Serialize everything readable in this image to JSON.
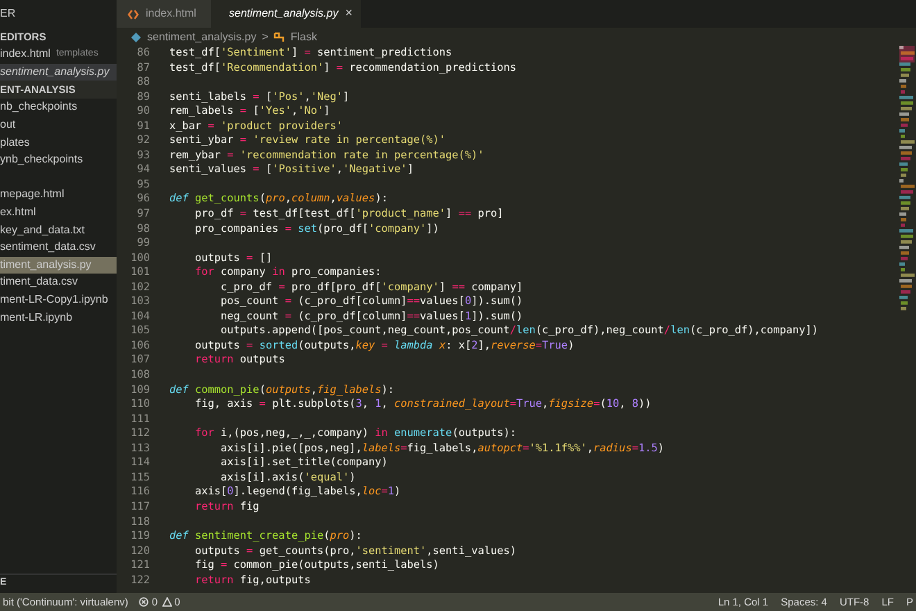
{
  "sidebar": {
    "title": "ER",
    "sections": [
      {
        "title": "EDITORS",
        "items": [
          {
            "label": "index.html",
            "hint": "templates",
            "selected": false,
            "italic": false
          },
          {
            "label": "sentiment_analysis.py",
            "selected": true,
            "italic": true
          }
        ]
      },
      {
        "title": "ENT-ANALYSIS",
        "items": [
          {
            "label": "nb_checkpoints",
            "selected": false
          },
          {
            "label": "out",
            "selected": false
          },
          {
            "label": "plates",
            "selected": false
          },
          {
            "label": "ynb_checkpoints",
            "selected": false
          },
          {
            "label": "mepage.html",
            "selected": false,
            "separated": true
          },
          {
            "label": "ex.html",
            "selected": false
          },
          {
            "label": "key_and_data.txt",
            "selected": false
          },
          {
            "label": "sentiment_data.csv",
            "selected": false
          },
          {
            "label": "timent_analysis.py",
            "selected": true
          },
          {
            "label": "timent_data.csv",
            "selected": false
          },
          {
            "label": "ment-LR-Copy1.ipynb",
            "selected": false
          },
          {
            "label": "ment-LR.ipynb",
            "selected": false
          }
        ]
      }
    ],
    "bottom": "E"
  },
  "tabs": [
    {
      "label": "index.html",
      "kind": "html",
      "selected": false
    },
    {
      "label": "sentiment_analysis.py",
      "kind": "python",
      "selected": true,
      "close": "×"
    }
  ],
  "breadcrumb": {
    "file": "sentiment_analysis.py",
    "separator": ">",
    "symbol": "Flask"
  },
  "code": [
    {
      "num": "86",
      "tokens": [
        {
          "kind": "plain",
          "text": "test_df["
        },
        {
          "kind": "string",
          "text": "'Sentiment'"
        },
        {
          "kind": "plain",
          "text": "] "
        },
        {
          "kind": "operator",
          "text": "="
        },
        {
          "kind": "plain",
          "text": " sentiment_predictions"
        }
      ]
    },
    {
      "num": "87",
      "tokens": [
        {
          "kind": "plain",
          "text": "test_df["
        },
        {
          "kind": "string",
          "text": "'Recommendation'"
        },
        {
          "kind": "plain",
          "text": "] "
        },
        {
          "kind": "operator",
          "text": "="
        },
        {
          "kind": "plain",
          "text": " recommendation_predictions"
        }
      ]
    },
    {
      "num": "88"
    },
    {
      "num": "89",
      "tokens": [
        {
          "kind": "plain",
          "text": "senti_labels "
        },
        {
          "kind": "operator",
          "text": "="
        },
        {
          "kind": "plain",
          "text": " ["
        },
        {
          "kind": "string",
          "text": "'Pos'"
        },
        {
          "kind": "plain",
          "text": ","
        },
        {
          "kind": "string",
          "text": "'Neg'"
        },
        {
          "kind": "plain",
          "text": "]"
        }
      ]
    },
    {
      "num": "90",
      "tokens": [
        {
          "kind": "plain",
          "text": "rem_labels "
        },
        {
          "kind": "operator",
          "text": "="
        },
        {
          "kind": "plain",
          "text": " ["
        },
        {
          "kind": "string",
          "text": "'Yes'"
        },
        {
          "kind": "plain",
          "text": ","
        },
        {
          "kind": "string",
          "text": "'No'"
        },
        {
          "kind": "plain",
          "text": "]"
        }
      ]
    },
    {
      "num": "91",
      "tokens": [
        {
          "kind": "plain",
          "text": "x_bar "
        },
        {
          "kind": "operator",
          "text": "="
        },
        {
          "kind": "string",
          "text": " 'product providers'"
        }
      ]
    },
    {
      "num": "92",
      "tokens": [
        {
          "kind": "plain",
          "text": "senti_ybar "
        },
        {
          "kind": "operator",
          "text": "="
        },
        {
          "kind": "string",
          "text": " 'review rate in percentage(%)'"
        }
      ]
    },
    {
      "num": "93",
      "tokens": [
        {
          "kind": "plain",
          "text": "rem_ybar "
        },
        {
          "kind": "operator",
          "text": "="
        },
        {
          "kind": "string",
          "text": " 'recommendation rate in percentage(%)'"
        }
      ]
    },
    {
      "num": "94",
      "tokens": [
        {
          "kind": "plain",
          "text": "senti_values "
        },
        {
          "kind": "operator",
          "text": "="
        },
        {
          "kind": "plain",
          "text": " ["
        },
        {
          "kind": "string",
          "text": "'Positive'"
        },
        {
          "kind": "plain",
          "text": ","
        },
        {
          "kind": "string",
          "text": "'Negative'"
        },
        {
          "kind": "plain",
          "text": "]"
        }
      ]
    },
    {
      "num": "95"
    },
    {
      "num": "96",
      "tokens": [
        {
          "kind": "storage",
          "text": "def"
        },
        {
          "kind": "function",
          "text": " get_counts"
        },
        {
          "kind": "plain",
          "text": "("
        },
        {
          "kind": "param",
          "text": "pro"
        },
        {
          "kind": "plain",
          "text": ","
        },
        {
          "kind": "param",
          "text": "column"
        },
        {
          "kind": "plain",
          "text": ","
        },
        {
          "kind": "param",
          "text": "values"
        },
        {
          "kind": "plain",
          "text": "):"
        }
      ]
    },
    {
      "num": "97",
      "tokens": [
        {
          "kind": "plain",
          "text": "    pro_df "
        },
        {
          "kind": "operator",
          "text": "="
        },
        {
          "kind": "plain",
          "text": " test_df[test_df["
        },
        {
          "kind": "string",
          "text": "'product_name'"
        },
        {
          "kind": "plain",
          "text": "] "
        },
        {
          "kind": "operator",
          "text": "=="
        },
        {
          "kind": "plain",
          "text": " pro]"
        }
      ]
    },
    {
      "num": "98",
      "tokens": [
        {
          "kind": "plain",
          "text": "    pro_companies "
        },
        {
          "kind": "operator",
          "text": "="
        },
        {
          "kind": "builtin",
          "text": " set"
        },
        {
          "kind": "plain",
          "text": "(pro_df["
        },
        {
          "kind": "string",
          "text": "'company'"
        },
        {
          "kind": "plain",
          "text": "])"
        }
      ]
    },
    {
      "num": "99"
    },
    {
      "num": "100",
      "tokens": [
        {
          "kind": "plain",
          "text": "    outputs "
        },
        {
          "kind": "operator",
          "text": "="
        },
        {
          "kind": "plain",
          "text": " []"
        }
      ]
    },
    {
      "num": "101",
      "tokens": [
        {
          "kind": "keyword",
          "text": "    for"
        },
        {
          "kind": "plain",
          "text": " company "
        },
        {
          "kind": "keyword",
          "text": "in"
        },
        {
          "kind": "plain",
          "text": " pro_companies:"
        }
      ]
    },
    {
      "num": "102",
      "tokens": [
        {
          "kind": "plain",
          "text": "        c_pro_df "
        },
        {
          "kind": "operator",
          "text": "="
        },
        {
          "kind": "plain",
          "text": " pro_df[pro_df["
        },
        {
          "kind": "string",
          "text": "'company'"
        },
        {
          "kind": "plain",
          "text": "] "
        },
        {
          "kind": "operator",
          "text": "=="
        },
        {
          "kind": "plain",
          "text": " company]"
        }
      ]
    },
    {
      "num": "103",
      "tokens": [
        {
          "kind": "plain",
          "text": "        pos_count "
        },
        {
          "kind": "operator",
          "text": "="
        },
        {
          "kind": "plain",
          "text": " (c_pro_df[column]"
        },
        {
          "kind": "operator",
          "text": "=="
        },
        {
          "kind": "plain",
          "text": "values["
        },
        {
          "kind": "number",
          "text": "0"
        },
        {
          "kind": "plain",
          "text": "]).sum()"
        }
      ]
    },
    {
      "num": "104",
      "tokens": [
        {
          "kind": "plain",
          "text": "        neg_count "
        },
        {
          "kind": "operator",
          "text": "="
        },
        {
          "kind": "plain",
          "text": " (c_pro_df[column]"
        },
        {
          "kind": "operator",
          "text": "=="
        },
        {
          "kind": "plain",
          "text": "values["
        },
        {
          "kind": "number",
          "text": "1"
        },
        {
          "kind": "plain",
          "text": "]).sum()"
        }
      ]
    },
    {
      "num": "105",
      "tokens": [
        {
          "kind": "plain",
          "text": "        outputs.append([pos_count,neg_count,pos_count"
        },
        {
          "kind": "operator",
          "text": "/"
        },
        {
          "kind": "builtin",
          "text": "len"
        },
        {
          "kind": "plain",
          "text": "(c_pro_df),neg_count"
        },
        {
          "kind": "operator",
          "text": "/"
        },
        {
          "kind": "builtin",
          "text": "len"
        },
        {
          "kind": "plain",
          "text": "(c_pro_df),company])"
        }
      ]
    },
    {
      "num": "106",
      "tokens": [
        {
          "kind": "plain",
          "text": "    outputs "
        },
        {
          "kind": "operator",
          "text": "="
        },
        {
          "kind": "builtin",
          "text": " sorted"
        },
        {
          "kind": "plain",
          "text": "(outputs,"
        },
        {
          "kind": "param",
          "text": "key"
        },
        {
          "kind": "operator",
          "text": " ="
        },
        {
          "kind": "storage",
          "text": " lambda"
        },
        {
          "kind": "param",
          "text": " x"
        },
        {
          "kind": "plain",
          "text": ": x["
        },
        {
          "kind": "number",
          "text": "2"
        },
        {
          "kind": "plain",
          "text": "],"
        },
        {
          "kind": "param",
          "text": "reverse"
        },
        {
          "kind": "operator",
          "text": "="
        },
        {
          "kind": "number",
          "text": "True"
        },
        {
          "kind": "plain",
          "text": ")"
        }
      ]
    },
    {
      "num": "107",
      "tokens": [
        {
          "kind": "keyword",
          "text": "    return"
        },
        {
          "kind": "plain",
          "text": " outputs"
        }
      ]
    },
    {
      "num": "108"
    },
    {
      "num": "109",
      "tokens": [
        {
          "kind": "storage",
          "text": "def"
        },
        {
          "kind": "function",
          "text": " common_pie"
        },
        {
          "kind": "plain",
          "text": "("
        },
        {
          "kind": "param",
          "text": "outputs"
        },
        {
          "kind": "plain",
          "text": ","
        },
        {
          "kind": "param",
          "text": "fig_labels"
        },
        {
          "kind": "plain",
          "text": "):"
        }
      ]
    },
    {
      "num": "110",
      "tokens": [
        {
          "kind": "plain",
          "text": "    fig, axis "
        },
        {
          "kind": "operator",
          "text": "="
        },
        {
          "kind": "plain",
          "text": " plt.subplots("
        },
        {
          "kind": "number",
          "text": "3"
        },
        {
          "kind": "plain",
          "text": ", "
        },
        {
          "kind": "number",
          "text": "1"
        },
        {
          "kind": "plain",
          "text": ", "
        },
        {
          "kind": "param",
          "text": "constrained_layout"
        },
        {
          "kind": "operator",
          "text": "="
        },
        {
          "kind": "number",
          "text": "True"
        },
        {
          "kind": "plain",
          "text": ","
        },
        {
          "kind": "param",
          "text": "figsize"
        },
        {
          "kind": "operator",
          "text": "="
        },
        {
          "kind": "plain",
          "text": "("
        },
        {
          "kind": "number",
          "text": "10"
        },
        {
          "kind": "plain",
          "text": ", "
        },
        {
          "kind": "number",
          "text": "8"
        },
        {
          "kind": "plain",
          "text": "))"
        }
      ]
    },
    {
      "num": "111"
    },
    {
      "num": "112",
      "tokens": [
        {
          "kind": "keyword",
          "text": "    for"
        },
        {
          "kind": "plain",
          "text": " i,(pos,neg,_,_,company) "
        },
        {
          "kind": "keyword",
          "text": "in"
        },
        {
          "kind": "builtin",
          "text": " enumerate"
        },
        {
          "kind": "plain",
          "text": "(outputs):"
        }
      ]
    },
    {
      "num": "113",
      "tokens": [
        {
          "kind": "plain",
          "text": "        axis[i].pie([pos,neg],"
        },
        {
          "kind": "param",
          "text": "labels"
        },
        {
          "kind": "operator",
          "text": "="
        },
        {
          "kind": "plain",
          "text": "fig_labels,"
        },
        {
          "kind": "param",
          "text": "autopct"
        },
        {
          "kind": "operator",
          "text": "="
        },
        {
          "kind": "string",
          "text": "'%1.1f%%'"
        },
        {
          "kind": "plain",
          "text": ","
        },
        {
          "kind": "param",
          "text": "radius"
        },
        {
          "kind": "operator",
          "text": "="
        },
        {
          "kind": "number",
          "text": "1.5"
        },
        {
          "kind": "plain",
          "text": ")"
        }
      ]
    },
    {
      "num": "114",
      "tokens": [
        {
          "kind": "plain",
          "text": "        axis[i].set_title(company)"
        }
      ]
    },
    {
      "num": "115",
      "tokens": [
        {
          "kind": "plain",
          "text": "        axis[i].axis("
        },
        {
          "kind": "string",
          "text": "'equal'"
        },
        {
          "kind": "plain",
          "text": ")"
        }
      ]
    },
    {
      "num": "116",
      "tokens": [
        {
          "kind": "plain",
          "text": "    axis["
        },
        {
          "kind": "number",
          "text": "0"
        },
        {
          "kind": "plain",
          "text": "].legend(fig_labels,"
        },
        {
          "kind": "param",
          "text": "loc"
        },
        {
          "kind": "operator",
          "text": "="
        },
        {
          "kind": "number",
          "text": "1"
        },
        {
          "kind": "plain",
          "text": ")"
        }
      ]
    },
    {
      "num": "117",
      "tokens": [
        {
          "kind": "keyword",
          "text": "    return"
        },
        {
          "kind": "plain",
          "text": " fig"
        }
      ]
    },
    {
      "num": "118"
    },
    {
      "num": "119",
      "tokens": [
        {
          "kind": "storage",
          "text": "def"
        },
        {
          "kind": "function",
          "text": " sentiment_create_pie"
        },
        {
          "kind": "plain",
          "text": "("
        },
        {
          "kind": "param",
          "text": "pro"
        },
        {
          "kind": "plain",
          "text": "):"
        }
      ]
    },
    {
      "num": "120",
      "tokens": [
        {
          "kind": "plain",
          "text": "    outputs "
        },
        {
          "kind": "operator",
          "text": "="
        },
        {
          "kind": "plain",
          "text": " get_counts(pro,"
        },
        {
          "kind": "string",
          "text": "'sentiment'"
        },
        {
          "kind": "plain",
          "text": ",senti_values)"
        }
      ]
    },
    {
      "num": "121",
      "tokens": [
        {
          "kind": "plain",
          "text": "    fig "
        },
        {
          "kind": "operator",
          "text": "="
        },
        {
          "kind": "plain",
          "text": " common_pie(outputs,senti_labels)"
        }
      ]
    },
    {
      "num": "122",
      "tokens": [
        {
          "kind": "keyword",
          "text": "    return"
        },
        {
          "kind": "plain",
          "text": " fig,outputs"
        }
      ]
    }
  ],
  "status_bar": {
    "interpreter": "bit ('Continuum': virtualenv)",
    "errors": "0",
    "warnings": "0",
    "right": [
      "Ln 1, Col 1",
      "Spaces: 4",
      "UTF-8",
      "LF",
      "P"
    ]
  }
}
